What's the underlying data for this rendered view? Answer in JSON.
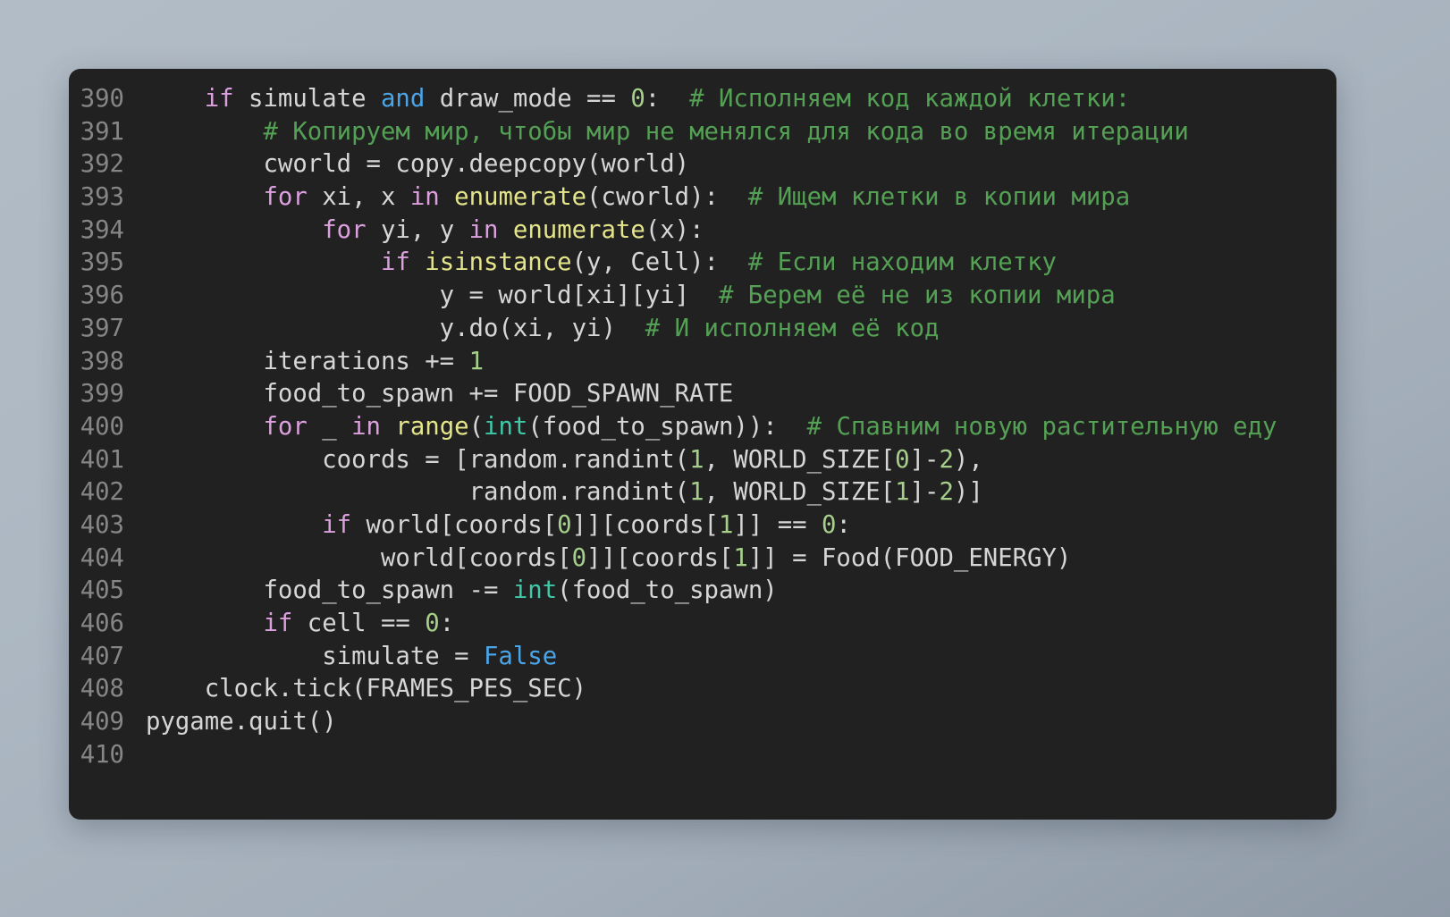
{
  "app": {
    "kind": "code-snippet-viewer",
    "background_color": "#aab5c0",
    "card_color": "#212121",
    "language": "python"
  },
  "theme": {
    "plain": "#d6d6d6",
    "keyword": "#dba0dd",
    "operator_keyword": "#4aa5e8",
    "builtin_function": "#e4e48a",
    "type": "#3fc9a8",
    "number": "#a5cf8a",
    "comment": "#54a054",
    "line_number": "#868686"
  },
  "code": {
    "first_line_number": 390,
    "last_line_number": 410,
    "lines": [
      {
        "number": "390",
        "text": "    if simulate and draw_mode == 0:  # Исполняем код каждой клетки:",
        "tokens": [
          {
            "t": "    ",
            "c": "plain"
          },
          {
            "t": "if",
            "c": "kw"
          },
          {
            "t": " simulate ",
            "c": "plain"
          },
          {
            "t": "and",
            "c": "op-kw"
          },
          {
            "t": " draw_mode == ",
            "c": "plain"
          },
          {
            "t": "0",
            "c": "num"
          },
          {
            "t": ":  ",
            "c": "plain"
          },
          {
            "t": "# Исполняем код каждой клетки:",
            "c": "cmt"
          }
        ]
      },
      {
        "number": "391",
        "text": "        # Копируем мир, чтобы мир не менялся для кода во время итерации",
        "tokens": [
          {
            "t": "        ",
            "c": "plain"
          },
          {
            "t": "# Копируем мир, чтобы мир не менялся для кода во время итерации",
            "c": "cmt"
          }
        ]
      },
      {
        "number": "392",
        "text": "        cworld = copy.deepcopy(world)",
        "tokens": [
          {
            "t": "        cworld = copy.deepcopy(world)",
            "c": "plain"
          }
        ]
      },
      {
        "number": "393",
        "text": "        for xi, x in enumerate(cworld):  # Ищем клетки в копии мира",
        "tokens": [
          {
            "t": "        ",
            "c": "plain"
          },
          {
            "t": "for",
            "c": "kw"
          },
          {
            "t": " xi, x ",
            "c": "plain"
          },
          {
            "t": "in",
            "c": "kw"
          },
          {
            "t": " ",
            "c": "plain"
          },
          {
            "t": "enumerate",
            "c": "fn"
          },
          {
            "t": "(cworld):  ",
            "c": "plain"
          },
          {
            "t": "# Ищем клетки в копии мира",
            "c": "cmt"
          }
        ]
      },
      {
        "number": "394",
        "text": "            for yi, y in enumerate(x):",
        "tokens": [
          {
            "t": "            ",
            "c": "plain"
          },
          {
            "t": "for",
            "c": "kw"
          },
          {
            "t": " yi, y ",
            "c": "plain"
          },
          {
            "t": "in",
            "c": "kw"
          },
          {
            "t": " ",
            "c": "plain"
          },
          {
            "t": "enumerate",
            "c": "fn"
          },
          {
            "t": "(x):",
            "c": "plain"
          }
        ]
      },
      {
        "number": "395",
        "text": "                if isinstance(y, Cell):  # Если находим клетку",
        "tokens": [
          {
            "t": "                ",
            "c": "plain"
          },
          {
            "t": "if",
            "c": "kw"
          },
          {
            "t": " ",
            "c": "plain"
          },
          {
            "t": "isinstance",
            "c": "fn"
          },
          {
            "t": "(y, Cell):  ",
            "c": "plain"
          },
          {
            "t": "# Если находим клетку",
            "c": "cmt"
          }
        ]
      },
      {
        "number": "396",
        "text": "                    y = world[xi][yi]  # Берем её не из копии мира",
        "tokens": [
          {
            "t": "                    y = world[xi][yi]  ",
            "c": "plain"
          },
          {
            "t": "# Берем её не из копии мира",
            "c": "cmt"
          }
        ]
      },
      {
        "number": "397",
        "text": "                    y.do(xi, yi)  # И исполняем её код",
        "tokens": [
          {
            "t": "                    y.do(xi, yi)  ",
            "c": "plain"
          },
          {
            "t": "# И исполняем её код",
            "c": "cmt"
          }
        ]
      },
      {
        "number": "398",
        "text": "        iterations += 1",
        "tokens": [
          {
            "t": "        iterations += ",
            "c": "plain"
          },
          {
            "t": "1",
            "c": "num"
          }
        ]
      },
      {
        "number": "399",
        "text": "        food_to_spawn += FOOD_SPAWN_RATE",
        "tokens": [
          {
            "t": "        food_to_spawn += FOOD_SPAWN_RATE",
            "c": "plain"
          }
        ]
      },
      {
        "number": "400",
        "text": "        for _ in range(int(food_to_spawn)):  # Спавним новую растительную еду",
        "tokens": [
          {
            "t": "        ",
            "c": "plain"
          },
          {
            "t": "for",
            "c": "kw"
          },
          {
            "t": " _ ",
            "c": "plain"
          },
          {
            "t": "in",
            "c": "kw"
          },
          {
            "t": " ",
            "c": "plain"
          },
          {
            "t": "range",
            "c": "fn"
          },
          {
            "t": "(",
            "c": "plain"
          },
          {
            "t": "int",
            "c": "type"
          },
          {
            "t": "(food_to_spawn)):  ",
            "c": "plain"
          },
          {
            "t": "# Спавним новую растительную еду",
            "c": "cmt"
          }
        ]
      },
      {
        "number": "401",
        "text": "            coords = [random.randint(1, WORLD_SIZE[0]-2),",
        "tokens": [
          {
            "t": "            coords = [random.randint(",
            "c": "plain"
          },
          {
            "t": "1",
            "c": "num"
          },
          {
            "t": ", WORLD_SIZE[",
            "c": "plain"
          },
          {
            "t": "0",
            "c": "num"
          },
          {
            "t": "]-",
            "c": "plain"
          },
          {
            "t": "2",
            "c": "num"
          },
          {
            "t": "),",
            "c": "plain"
          }
        ]
      },
      {
        "number": "402",
        "text": "                      random.randint(1, WORLD_SIZE[1]-2)]",
        "tokens": [
          {
            "t": "                      random.randint(",
            "c": "plain"
          },
          {
            "t": "1",
            "c": "num"
          },
          {
            "t": ", WORLD_SIZE[",
            "c": "plain"
          },
          {
            "t": "1",
            "c": "num"
          },
          {
            "t": "]-",
            "c": "plain"
          },
          {
            "t": "2",
            "c": "num"
          },
          {
            "t": ")]",
            "c": "plain"
          }
        ]
      },
      {
        "number": "403",
        "text": "            if world[coords[0]][coords[1]] == 0:",
        "tokens": [
          {
            "t": "            ",
            "c": "plain"
          },
          {
            "t": "if",
            "c": "kw"
          },
          {
            "t": " world[coords[",
            "c": "plain"
          },
          {
            "t": "0",
            "c": "num"
          },
          {
            "t": "]][coords[",
            "c": "plain"
          },
          {
            "t": "1",
            "c": "num"
          },
          {
            "t": "]] == ",
            "c": "plain"
          },
          {
            "t": "0",
            "c": "num"
          },
          {
            "t": ":",
            "c": "plain"
          }
        ]
      },
      {
        "number": "404",
        "text": "                world[coords[0]][coords[1]] = Food(FOOD_ENERGY)",
        "tokens": [
          {
            "t": "                world[coords[",
            "c": "plain"
          },
          {
            "t": "0",
            "c": "num"
          },
          {
            "t": "]][coords[",
            "c": "plain"
          },
          {
            "t": "1",
            "c": "num"
          },
          {
            "t": "]] = Food(FOOD_ENERGY)",
            "c": "plain"
          }
        ]
      },
      {
        "number": "405",
        "text": "        food_to_spawn -= int(food_to_spawn)",
        "tokens": [
          {
            "t": "        food_to_spawn -= ",
            "c": "plain"
          },
          {
            "t": "int",
            "c": "type"
          },
          {
            "t": "(food_to_spawn)",
            "c": "plain"
          }
        ]
      },
      {
        "number": "406",
        "text": "        if cell == 0:",
        "tokens": [
          {
            "t": "        ",
            "c": "plain"
          },
          {
            "t": "if",
            "c": "kw"
          },
          {
            "t": " cell == ",
            "c": "plain"
          },
          {
            "t": "0",
            "c": "num"
          },
          {
            "t": ":",
            "c": "plain"
          }
        ]
      },
      {
        "number": "407",
        "text": "            simulate = False",
        "tokens": [
          {
            "t": "            simulate = ",
            "c": "plain"
          },
          {
            "t": "False",
            "c": "op-kw"
          }
        ]
      },
      {
        "number": "408",
        "text": "    clock.tick(FRAMES_PES_SEC)",
        "tokens": [
          {
            "t": "    clock.tick(FRAMES_PES_SEC)",
            "c": "plain"
          }
        ]
      },
      {
        "number": "409",
        "text": "pygame.quit()",
        "tokens": [
          {
            "t": "pygame.quit()",
            "c": "plain"
          }
        ]
      },
      {
        "number": "410",
        "text": "",
        "tokens": []
      }
    ]
  }
}
